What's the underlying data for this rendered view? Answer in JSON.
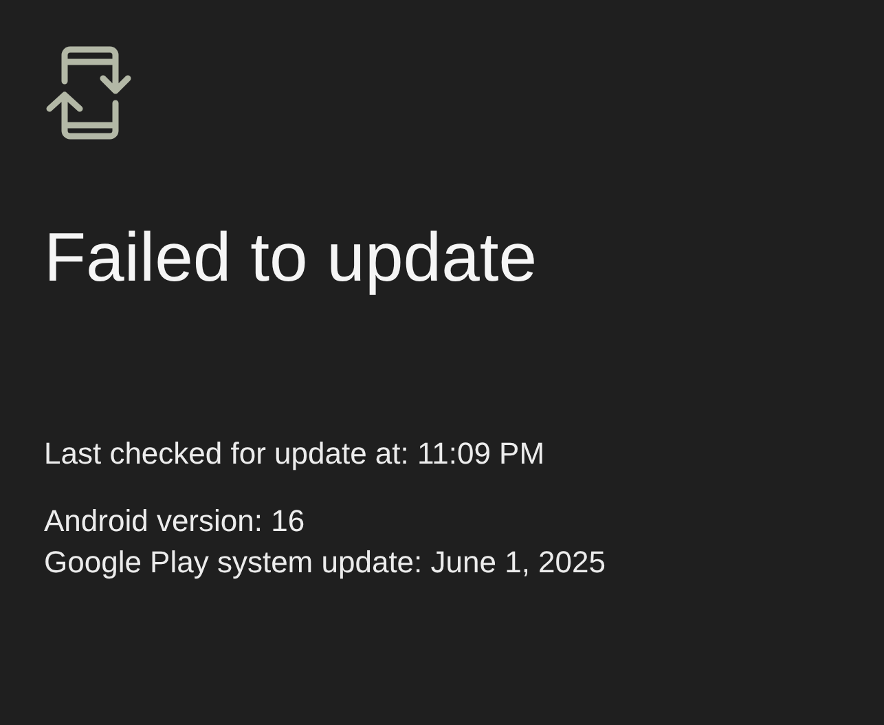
{
  "title": "Failed to update",
  "details": [
    "Last checked for update at: 11:09 PM"
  ],
  "versions": [
    "Android version: 16",
    "Google Play system update: June 1, 2025"
  ]
}
